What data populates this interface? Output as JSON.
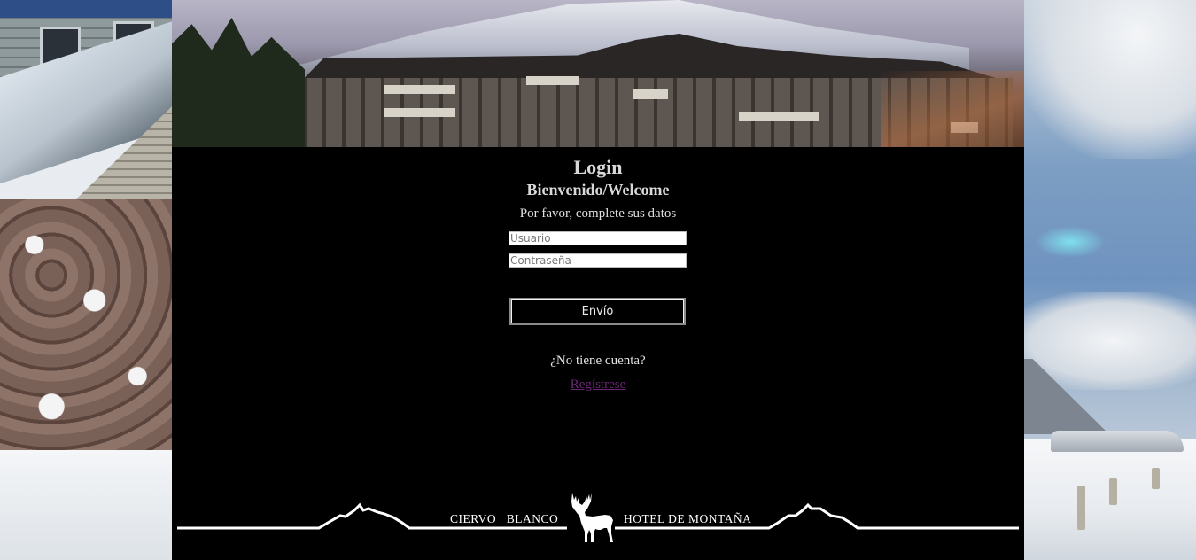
{
  "page": {
    "title": "Login",
    "subtitle": "Bienvenido/Welcome",
    "instruction": "Por favor, complete sus datos"
  },
  "form": {
    "username_placeholder": "Usuario",
    "password_placeholder": "Contraseña",
    "submit_label": "Envío"
  },
  "signup": {
    "question": "¿No tiene cuenta?",
    "link_label": "Regístrese"
  },
  "logo": {
    "text_left": "CIERVO   BLANCO",
    "text_right": "HOTEL DE MONTAÑA",
    "icon": "deer-icon"
  },
  "colors": {
    "background": "#000000",
    "text": "#d9d9d9",
    "link_visited": "#6e2677"
  }
}
